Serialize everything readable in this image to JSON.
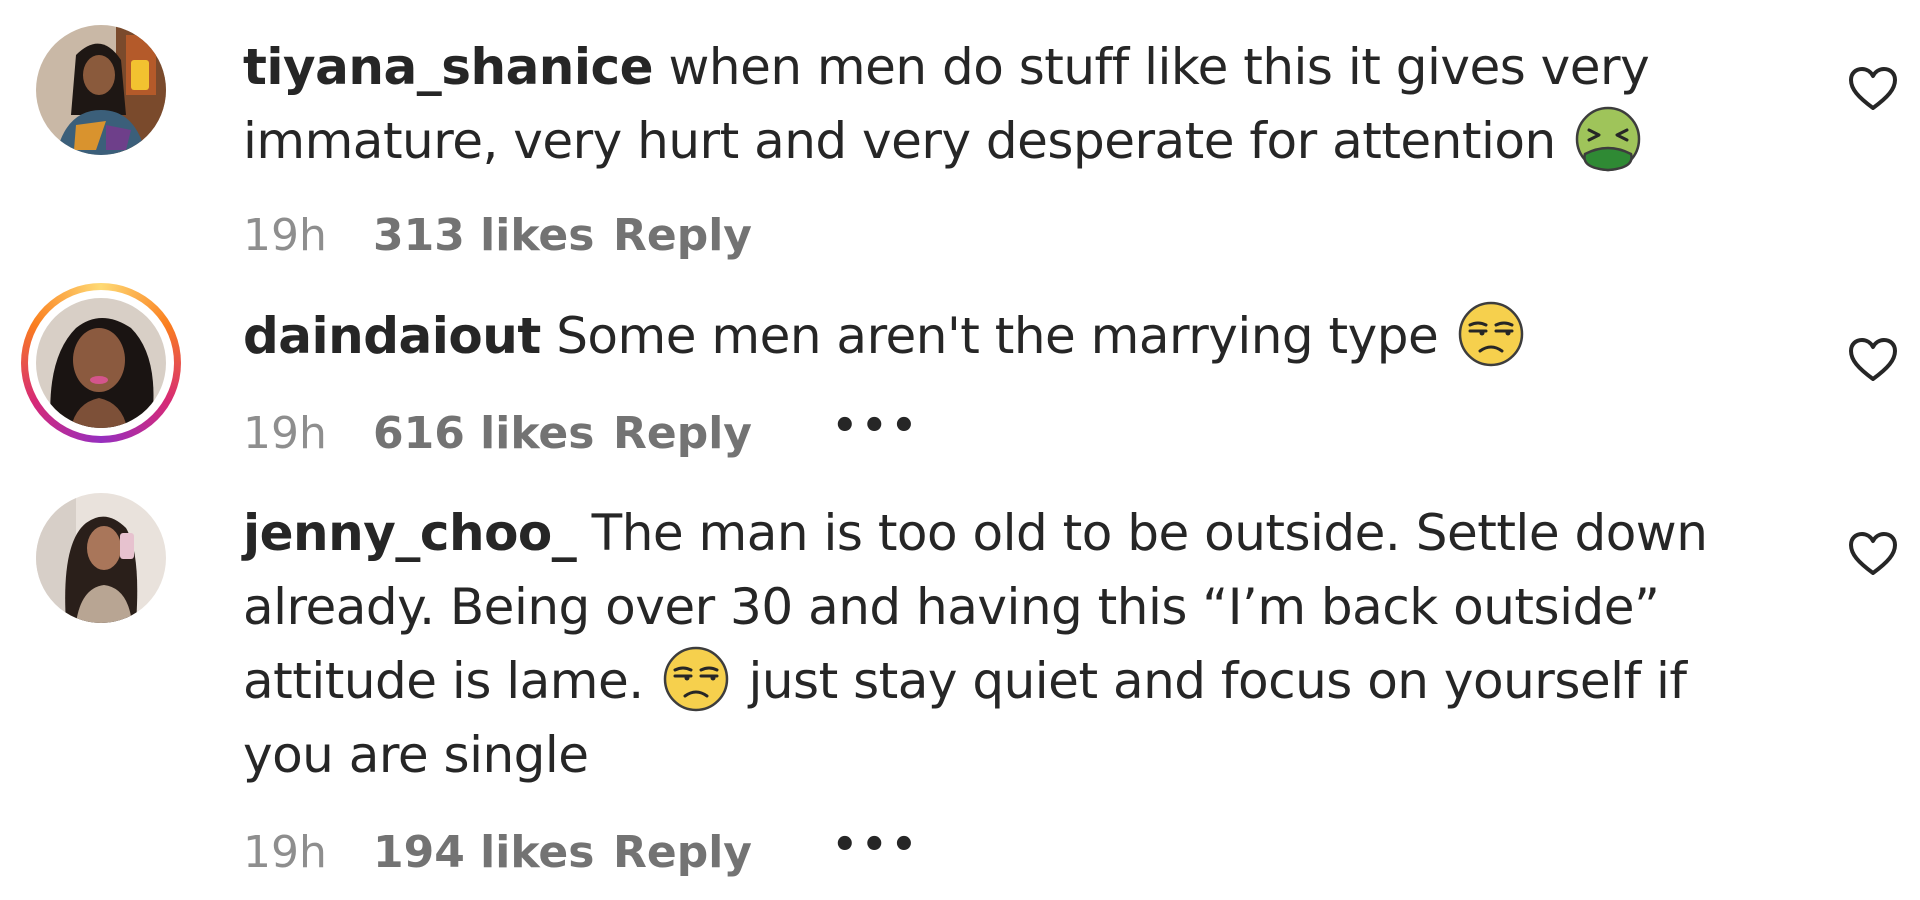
{
  "comments": [
    {
      "username": "tiyana_shanice",
      "text_before_emoji": " when men do stuff like this it gives very immature, very hurt and very desperate for attention ",
      "text_after_emoji": "",
      "emoji": "nauseated-face-icon",
      "time": "19h",
      "likes": "313 likes",
      "reply": "Reply",
      "has_story_ring": false
    },
    {
      "username": "daindaiout",
      "text_before_emoji": " Some men aren't the marrying type ",
      "text_after_emoji": "",
      "emoji": "unamused-face-icon",
      "time": "19h",
      "likes": "616 likes",
      "reply": "Reply",
      "more": "•••",
      "has_story_ring": true
    },
    {
      "username": "jenny_choo_",
      "text_before_emoji": " The man is too old to be outside. Settle down already. Being over 30 and having this “I’m back outside” attitude is lame. ",
      "text_after_emoji": " just stay quiet and focus on yourself if you are single",
      "emoji": "unamused-face-icon",
      "time": "19h",
      "likes": "194 likes",
      "reply": "Reply",
      "more": "•••",
      "has_story_ring": false
    }
  ],
  "colors": {
    "text": "#262626",
    "meta": "#737373",
    "story_ring": [
      "#feda75",
      "#fa7e1e",
      "#d62976",
      "#962fbf"
    ]
  }
}
